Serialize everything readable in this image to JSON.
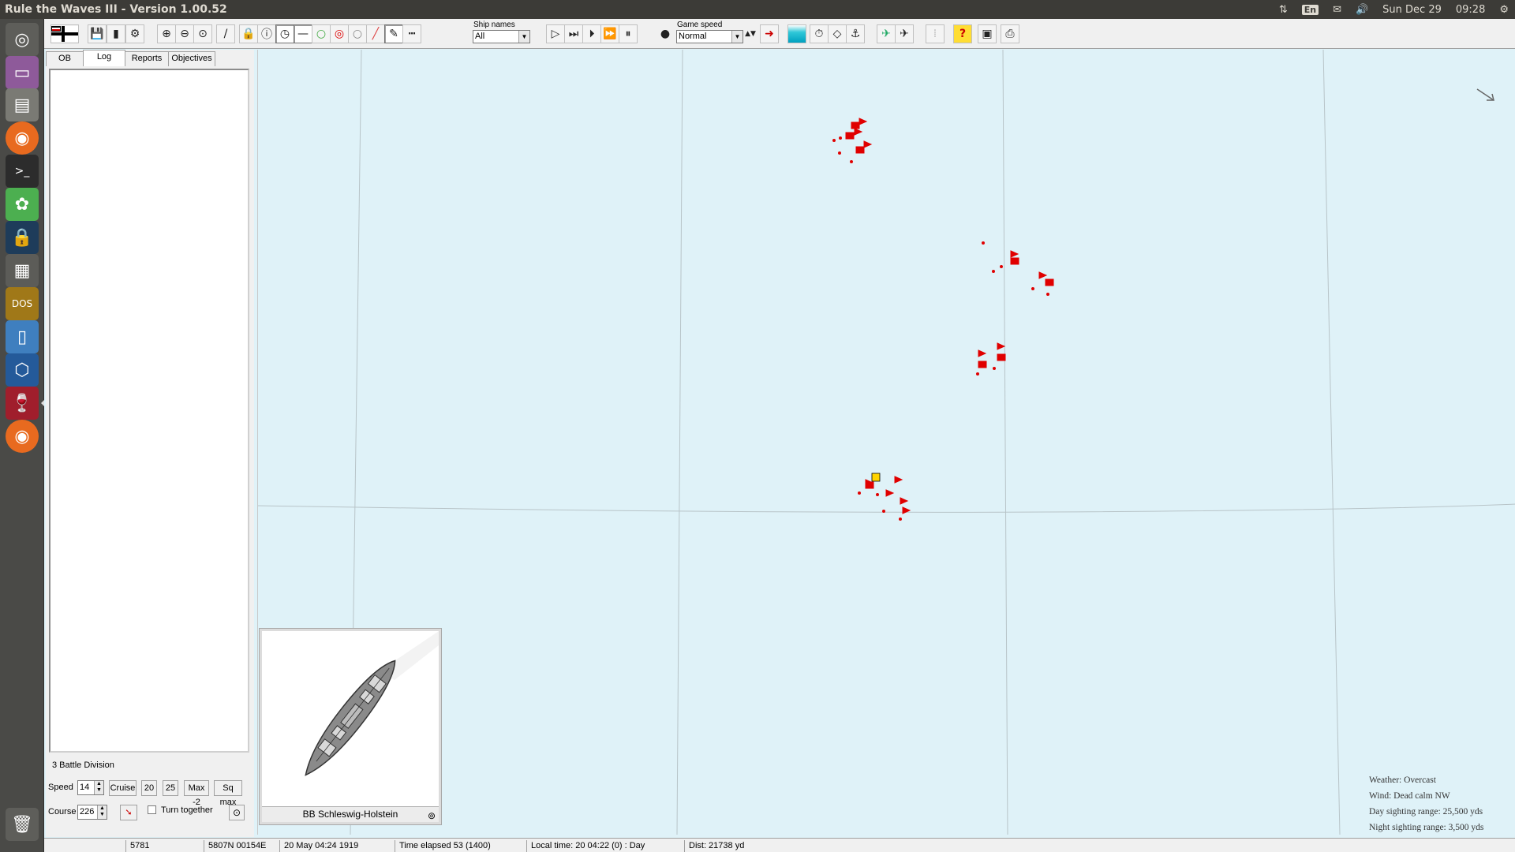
{
  "os": {
    "window_title": "Rule the Waves III - Version 1.00.52",
    "tray": {
      "lang": "En",
      "date": "Sun Dec 29",
      "time": "09:28"
    }
  },
  "toolbar": {
    "ship_names_label": "Ship names",
    "ship_names_value": "All",
    "game_speed_label": "Game speed",
    "game_speed_value": "Normal"
  },
  "left_panel": {
    "tabs": [
      "OB",
      "Log",
      "Reports",
      "Objectives"
    ],
    "active_tab": "Log",
    "division": "3 Battle Division",
    "speed_label": "Speed",
    "speed_value": "14",
    "speed_buttons": [
      "Cruise",
      "20",
      "25",
      "Max -2",
      "Sq max"
    ],
    "course_label": "Course",
    "course_value": "226",
    "turn_together_label": "Turn together"
  },
  "ship_panel": {
    "name": "BB Schleswig-Holstein"
  },
  "weather": {
    "lines": [
      "Weather: Overcast",
      "Wind: Dead calm  NW",
      "Day sighting range: 25,500 yds",
      "Night sighting range: 3,500 yds"
    ]
  },
  "status_bar": [
    "5781",
    "5807N 00154E",
    "20 May 04:24 1919",
    "Time elapsed 53 (1400)",
    "Local time: 20 04:22 (0) : Day",
    "Dist: 21738 yd"
  ],
  "colors": {
    "sea": "#dff2f8",
    "enemy_flag": "#e00000",
    "selected_marker": "#ffd400"
  }
}
